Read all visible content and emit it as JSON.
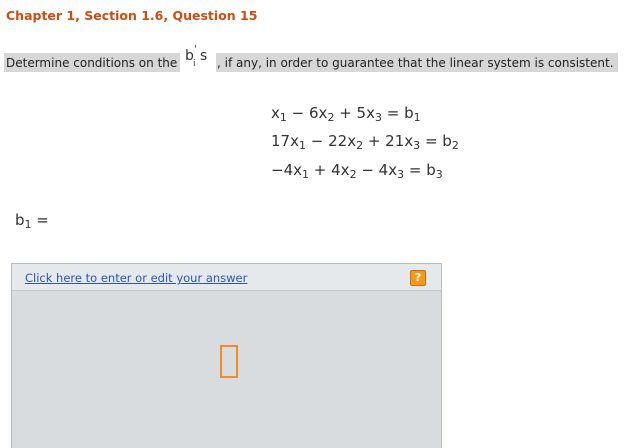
{
  "header": {
    "title": "Chapter 1, Section 1.6, Question 15"
  },
  "question": {
    "text_before": "Determine conditions on the ",
    "symbol": {
      "base": "b",
      "prime": "'",
      "subscript": "i",
      "suffix": "s"
    },
    "text_after": ", if any, in order to guarantee that the linear system is consistent."
  },
  "system": {
    "eq1": {
      "x1": "x",
      "s1": "1",
      "op1": " − 6",
      "x2": "x",
      "s2": "2",
      "op2": " + 5",
      "x3": "x",
      "s3": "3",
      "eq": " = ",
      "b": "b",
      "sb": "1",
      "lead": ""
    },
    "eq2": {
      "lead": "17",
      "x1": "x",
      "s1": "1",
      "op1": " − 22",
      "x2": "x",
      "s2": "2",
      "op2": " + 21",
      "x3": "x",
      "s3": "3",
      "eq": " = ",
      "b": "b",
      "sb": "2"
    },
    "eq3": {
      "lead": "−4",
      "x1": "x",
      "s1": "1",
      "op1": " + 4",
      "x2": "x",
      "s2": "2",
      "op2": " − 4",
      "x3": "x",
      "s3": "3",
      "eq": " = ",
      "b": "b",
      "sb": "3"
    }
  },
  "answer": {
    "label_base": "b",
    "label_sub": "1",
    "label_eq": " =",
    "link_text": "Click here to enter or edit your answer",
    "help_icon": "?"
  }
}
